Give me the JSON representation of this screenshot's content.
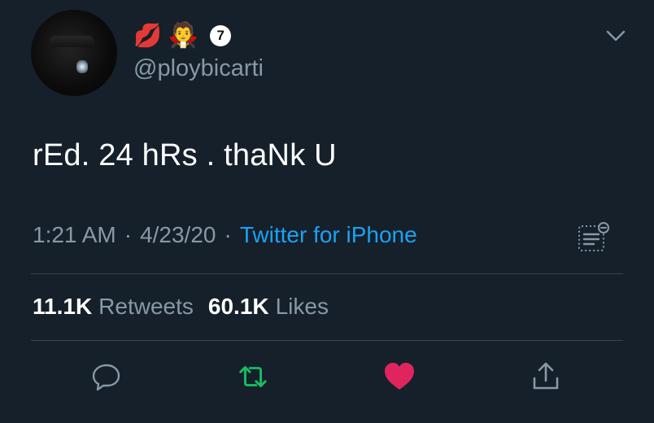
{
  "user": {
    "avatar": "avatar",
    "emoji_1": "kiss-mark-icon",
    "emoji_2": "vampire-icon",
    "badge": "7",
    "handle": "@ploybicarti"
  },
  "tweet": {
    "text": "rEd. 24 hRs . thaNk U",
    "time": "1:21 AM",
    "separator_1": "·",
    "date": "4/23/20",
    "separator_2": "·",
    "source": "Twitter for iPhone"
  },
  "stats": {
    "retweets_count": "11.1K",
    "retweets_label": "Retweets",
    "likes_count": "60.1K",
    "likes_label": "Likes"
  },
  "actions": {
    "reply": "reply-icon",
    "retweet": "retweet-icon",
    "like": "heart-icon",
    "share": "share-icon"
  },
  "colors": {
    "background": "#15202b",
    "text_primary": "#ffffff",
    "text_secondary": "#8899a6",
    "link": "#1da1f2",
    "retweet": "#17bf63",
    "like": "#e0245e",
    "divider": "#38444d"
  }
}
